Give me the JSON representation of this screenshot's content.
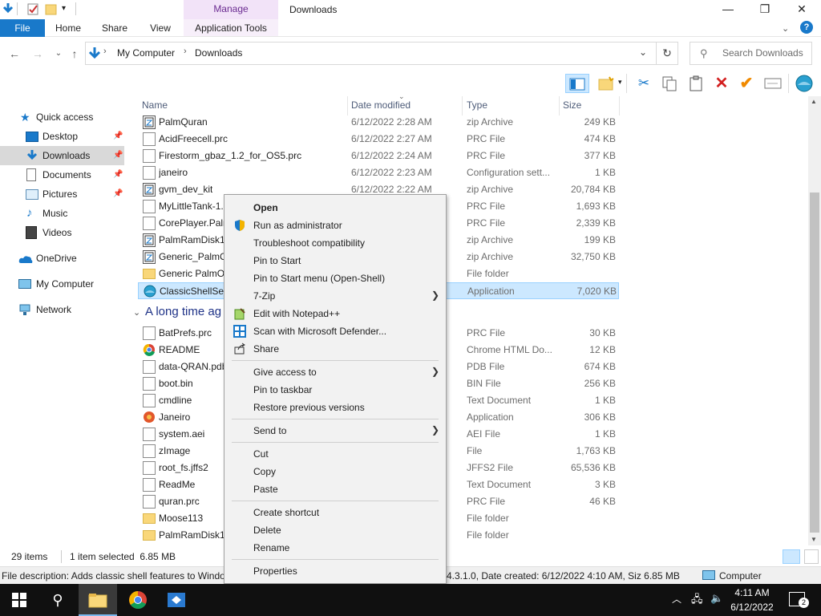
{
  "window": {
    "title": "Downloads",
    "manage_tab": "Manage",
    "minimize": "—",
    "maximize": "❐",
    "close": "✕"
  },
  "ribbon": {
    "tabs": [
      "File",
      "Home",
      "Share",
      "View",
      "Application Tools"
    ],
    "help": "?"
  },
  "address": {
    "crumbs": [
      "My Computer",
      "Downloads"
    ],
    "search_placeholder": "Search Downloads"
  },
  "nav": {
    "items": [
      {
        "label": "Quick access",
        "icon": "star-icon"
      },
      {
        "label": "Desktop",
        "icon": "desktop-icon",
        "pinned": true
      },
      {
        "label": "Downloads",
        "icon": "download-icon",
        "pinned": true,
        "selected": true
      },
      {
        "label": "Documents",
        "icon": "documents-icon",
        "pinned": true
      },
      {
        "label": "Pictures",
        "icon": "pictures-icon",
        "pinned": true
      },
      {
        "label": "Music",
        "icon": "music-icon"
      },
      {
        "label": "Videos",
        "icon": "videos-icon"
      },
      {
        "label": "OneDrive",
        "icon": "cloud-icon"
      },
      {
        "label": "My Computer",
        "icon": "computer-icon"
      },
      {
        "label": "Network",
        "icon": "network-icon"
      }
    ]
  },
  "columns": {
    "name": "Name",
    "date": "Date modified",
    "type": "Type",
    "size": "Size"
  },
  "files_recent": [
    {
      "name": "PalmQuran",
      "date": "6/12/2022 2:28 AM",
      "type": "zip Archive",
      "size": "249 KB",
      "icon": "zip"
    },
    {
      "name": "AcidFreecell.prc",
      "date": "6/12/2022 2:27 AM",
      "type": "PRC File",
      "size": "474 KB",
      "icon": "doc"
    },
    {
      "name": "Firestorm_gbaz_1.2_for_OS5.prc",
      "date": "6/12/2022 2:24 AM",
      "type": "PRC File",
      "size": "377 KB",
      "icon": "doc"
    },
    {
      "name": "janeiro",
      "date": "6/12/2022 2:23 AM",
      "type": "Configuration sett...",
      "size": "1 KB",
      "icon": "doc"
    },
    {
      "name": "gvm_dev_kit",
      "date": "6/12/2022 2:22 AM",
      "type": "zip Archive",
      "size": "20,784 KB",
      "icon": "zip"
    },
    {
      "name": "MyLittleTank-1.",
      "date": "",
      "type": "PRC File",
      "size": "1,693 KB",
      "icon": "doc"
    },
    {
      "name": "CorePlayer.Paln",
      "date": "",
      "type": "PRC File",
      "size": "2,339 KB",
      "icon": "doc"
    },
    {
      "name": "PalmRamDisk10",
      "date": "",
      "type": "zip Archive",
      "size": "199 KB",
      "icon": "zip"
    },
    {
      "name": "Generic_PalmO",
      "date": "",
      "type": "zip Archive",
      "size": "32,750 KB",
      "icon": "zip"
    },
    {
      "name": "Generic PalmOS",
      "date": "",
      "type": "File folder",
      "size": "",
      "icon": "folder"
    },
    {
      "name": "ClassicShellSetu",
      "date": "",
      "type": "Application",
      "size": "7,020 KB",
      "icon": "shell",
      "selected": true
    }
  ],
  "group_older": "A long time ag",
  "files_older": [
    {
      "name": "BatPrefs.prc",
      "type": "PRC File",
      "size": "30 KB",
      "icon": "doc"
    },
    {
      "name": "README",
      "type": "Chrome HTML Do...",
      "size": "12 KB",
      "icon": "chrome"
    },
    {
      "name": "data-QRAN.pdb",
      "type": "PDB File",
      "size": "674 KB",
      "icon": "doc"
    },
    {
      "name": "boot.bin",
      "type": "BIN File",
      "size": "256 KB",
      "icon": "doc"
    },
    {
      "name": "cmdline",
      "type": "Text Document",
      "size": "1 KB",
      "icon": "doc"
    },
    {
      "name": "Janeiro",
      "type": "Application",
      "size": "306 KB",
      "icon": "app"
    },
    {
      "name": "system.aei",
      "type": "AEI File",
      "size": "1 KB",
      "icon": "doc"
    },
    {
      "name": "zImage",
      "type": "File",
      "size": "1,763 KB",
      "icon": "doc"
    },
    {
      "name": "root_fs.jffs2",
      "type": "JFFS2 File",
      "size": "65,536 KB",
      "icon": "doc"
    },
    {
      "name": "ReadMe",
      "type": "Text Document",
      "size": "3 KB",
      "icon": "doc"
    },
    {
      "name": "quran.prc",
      "type": "PRC File",
      "size": "46 KB",
      "icon": "doc"
    },
    {
      "name": "Moose113",
      "type": "File folder",
      "size": "",
      "icon": "folder"
    },
    {
      "name": "PalmRamDisk10",
      "type": "File folder",
      "size": "",
      "icon": "folder"
    }
  ],
  "status": {
    "items": "29 items",
    "selected": "1 item selected  6.85 MB"
  },
  "details": {
    "left": "File description: Adds classic shell features to Windo",
    "right": "4.3.1.0, Date created: 6/12/2022 4:10 AM, Siz 6.85 MB",
    "computer": "Computer"
  },
  "context_menu": {
    "items": [
      {
        "label": "Open",
        "bold": true
      },
      {
        "label": "Run as administrator",
        "icon": "shield-icon"
      },
      {
        "label": "Troubleshoot compatibility"
      },
      {
        "label": "Pin to Start"
      },
      {
        "label": "Pin to Start menu (Open-Shell)"
      },
      {
        "label": "7-Zip",
        "submenu": true
      },
      {
        "label": "Edit with Notepad++",
        "icon": "notepadpp-icon"
      },
      {
        "label": "Scan with Microsoft Defender...",
        "icon": "defender-icon"
      },
      {
        "label": "Share",
        "icon": "share-icon"
      },
      {
        "separator": true
      },
      {
        "label": "Give access to",
        "submenu": true
      },
      {
        "label": "Pin to taskbar"
      },
      {
        "label": "Restore previous versions"
      },
      {
        "separator": true
      },
      {
        "label": "Send to",
        "submenu": true
      },
      {
        "separator": true
      },
      {
        "label": "Cut"
      },
      {
        "label": "Copy"
      },
      {
        "label": "Paste"
      },
      {
        "separator": true
      },
      {
        "label": "Create shortcut"
      },
      {
        "label": "Delete"
      },
      {
        "label": "Rename"
      },
      {
        "separator": true
      },
      {
        "label": "Properties"
      }
    ]
  },
  "taskbar": {
    "time": "4:11 AM",
    "date": "6/12/2022",
    "notification_count": "2"
  },
  "colors": {
    "accent": "#1979ca",
    "selection": "#cce8ff",
    "manage": "#6b2c91"
  }
}
